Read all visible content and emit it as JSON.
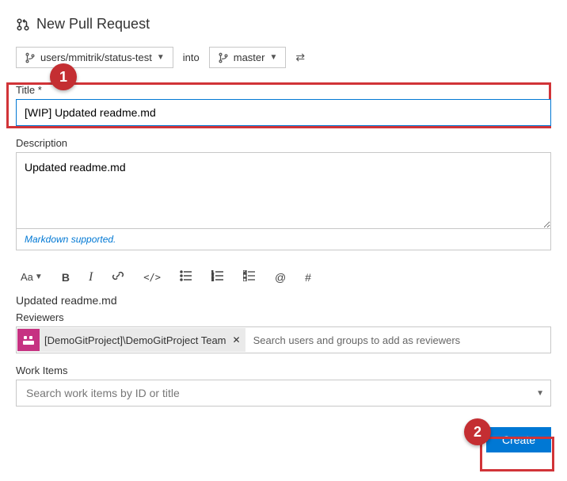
{
  "header": {
    "title": "New Pull Request"
  },
  "branches": {
    "source": "users/mmitrik/status-test",
    "into_label": "into",
    "target": "master"
  },
  "title_field": {
    "label": "Title",
    "required_mark": "*",
    "value": "[WIP] Updated readme.md"
  },
  "description_field": {
    "label": "Description",
    "value": "Updated readme.md",
    "footer_text": "Markdown supported."
  },
  "toolbar": {
    "font_size": "Aa",
    "bold": "B",
    "italic": "I",
    "link": "link",
    "code": "</>",
    "ul": "ul",
    "ol": "ol",
    "checklist": "check",
    "mention": "@",
    "hash": "#"
  },
  "preview": {
    "text": "Updated readme.md"
  },
  "reviewers": {
    "label": "Reviewers",
    "chip": "[DemoGitProject]\\DemoGitProject Team",
    "placeholder": "Search users and groups to add as reviewers"
  },
  "workitems": {
    "label": "Work Items",
    "placeholder": "Search work items by ID or title"
  },
  "actions": {
    "create": "Create"
  },
  "callouts": {
    "one": "1",
    "two": "2"
  }
}
